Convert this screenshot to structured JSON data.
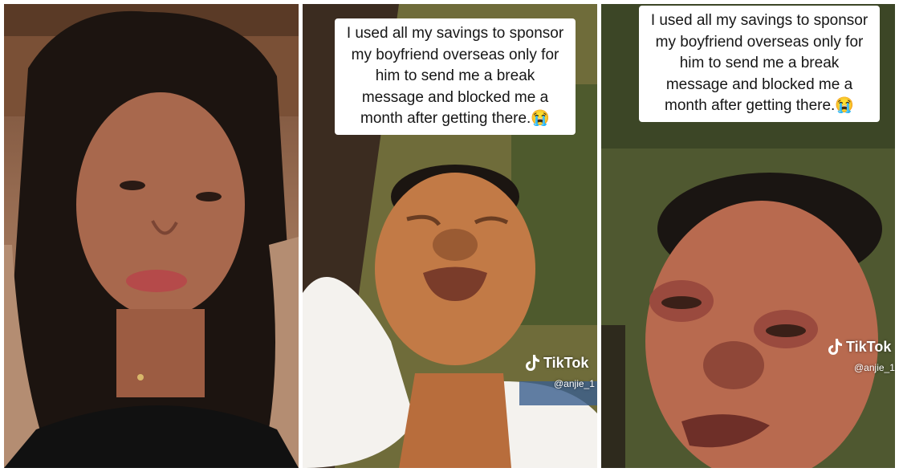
{
  "panels": [
    {
      "name": "panel-left"
    },
    {
      "name": "panel-middle",
      "caption": "I used all my savings to sponsor my boyfriend overseas only for him to send me a break message and blocked me a month after getting there.😭",
      "watermark": "TikTok",
      "handle": "@anjie_1"
    },
    {
      "name": "panel-right",
      "caption": "I used all my savings to sponsor my boyfriend overseas only for him to send me a break message and blocked me a month after getting there.😭",
      "watermark": "TikTok",
      "handle": "@anjie_1"
    }
  ],
  "icons": {
    "tiktok": "tiktok-logo-icon"
  }
}
